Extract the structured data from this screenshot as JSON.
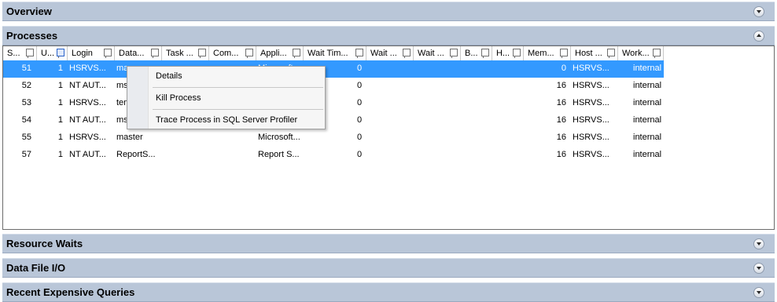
{
  "panels": {
    "overview": "Overview",
    "processes": "Processes",
    "resource_waits": "Resource Waits",
    "data_file_io": "Data File I/O",
    "recent_queries": "Recent Expensive Queries"
  },
  "columns": [
    "S...",
    "U...",
    "Login",
    "Data...",
    "Task ...",
    "Com...",
    "Appli...",
    "Wait Tim...",
    "Wait ...",
    "Wait ...",
    "B...",
    "H...",
    "Mem...",
    "Host ...",
    "Work..."
  ],
  "rows": [
    {
      "session": "51",
      "user": "1",
      "login": "HSRVS...",
      "database": "ma",
      "application": "Microsoft...",
      "wait_time": "0",
      "memory": "0",
      "host": "HSRVS...",
      "workload": "internal"
    },
    {
      "session": "52",
      "user": "1",
      "login": "NT AUT...",
      "database": "msd",
      "application": "",
      "wait_time": "0",
      "memory": "16",
      "host": "HSRVS...",
      "workload": "internal"
    },
    {
      "session": "53",
      "user": "1",
      "login": "HSRVS...",
      "database": "tem",
      "application": "",
      "wait_time": "0",
      "memory": "16",
      "host": "HSRVS...",
      "workload": "internal"
    },
    {
      "session": "54",
      "user": "1",
      "login": "NT AUT...",
      "database": "msd",
      "application": "",
      "wait_time": "0",
      "memory": "16",
      "host": "HSRVS...",
      "workload": "internal"
    },
    {
      "session": "55",
      "user": "1",
      "login": "HSRVS...",
      "database": "master",
      "application": "Microsoft...",
      "wait_time": "0",
      "memory": "16",
      "host": "HSRVS...",
      "workload": "internal"
    },
    {
      "session": "57",
      "user": "1",
      "login": "NT AUT...",
      "database": "ReportS...",
      "application": "Report S...",
      "wait_time": "0",
      "memory": "16",
      "host": "HSRVS...",
      "workload": "internal"
    }
  ],
  "context_menu": {
    "details": "Details",
    "kill": "Kill Process",
    "trace": "Trace Process in SQL Server Profiler"
  },
  "colors": {
    "panel_header": "#b9c6d8",
    "selection": "#3399ff"
  }
}
